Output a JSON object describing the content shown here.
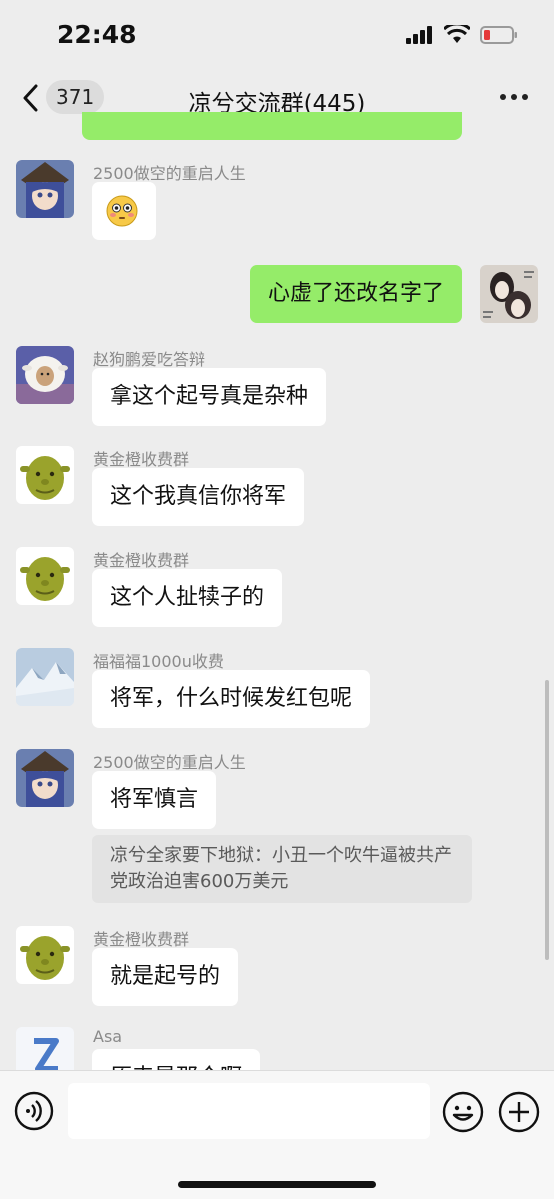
{
  "status": {
    "time": "22:48"
  },
  "nav": {
    "badge": "371",
    "title": "凉兮交流群(445)"
  },
  "messages": [
    {
      "sender": "2500做空的重启人生",
      "text": "😳",
      "avatar": "anime-girl-avatar"
    },
    {
      "sender": "赵狗鹏爱吃答辩",
      "text": "拿这个起号真是杂种",
      "avatar": "sheep-mask-avatar"
    },
    {
      "sender": "黄金橙收费群",
      "text": "这个我真信你将军",
      "avatar": "shrek-avatar"
    },
    {
      "sender": "黄金橙收费群",
      "text": "这个人扯犊子的",
      "avatar": "shrek-avatar"
    },
    {
      "sender": "福福福1000u收费",
      "text": "将军，什么时候发红包呢",
      "avatar": "snow-mountain-avatar"
    },
    {
      "sender": "2500做空的重启人生",
      "text": "将军慎言",
      "avatar": "anime-girl-avatar",
      "quote": "凉兮全家要下地狱：小丑一个吹牛逼被共产党政治迫害600万美元"
    },
    {
      "sender": "黄金橙收费群",
      "text": "就是起号的",
      "avatar": "shrek-avatar"
    },
    {
      "sender": "Asa",
      "text": "原来是那个啊",
      "avatar": "letter-z-avatar"
    }
  ],
  "self_message": {
    "text": "心虚了还改名字了",
    "avatar": "manga-couple-avatar"
  },
  "colors": {
    "background": "#ededed",
    "self_bubble": "#95ec69",
    "other_bubble": "#ffffff",
    "quote_bg": "#e3e3e3"
  },
  "icons": [
    "back-chevron-icon",
    "more-dots-icon",
    "voice-icon",
    "emoji-icon",
    "plus-icon",
    "signal-icon",
    "wifi-icon",
    "battery-icon"
  ]
}
